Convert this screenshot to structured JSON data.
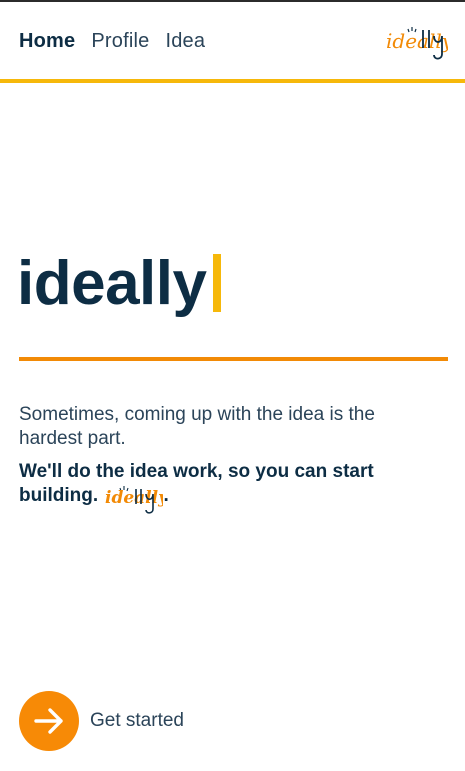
{
  "nav": {
    "links": [
      {
        "label": "Home",
        "active": true
      },
      {
        "label": "Profile",
        "active": false
      },
      {
        "label": "Idea",
        "active": false
      }
    ],
    "logo_text": "ideally"
  },
  "hero": {
    "title": "ideally"
  },
  "content": {
    "intro": "Sometimes, coming up with the idea is the hardest part.",
    "tagline": "We'll do the idea work, so you can start building.",
    "tagline_logo_text": "ideally",
    "tagline_end": "."
  },
  "cta": {
    "label": "Get started",
    "icon": "arrow-right-icon"
  },
  "colors": {
    "navy": "#0d2d44",
    "accent_yellow": "#f6b80a",
    "accent_orange": "#f28a06"
  }
}
